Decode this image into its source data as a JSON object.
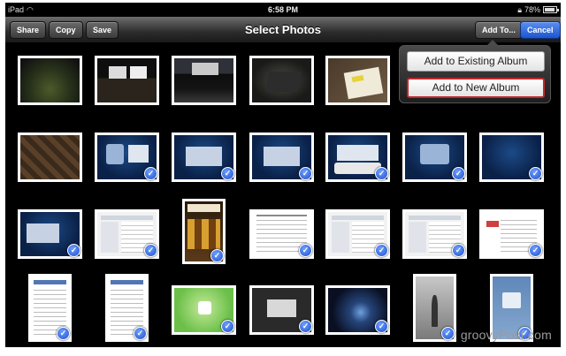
{
  "status": {
    "device": "iPad",
    "time": "6:58 PM",
    "battery": "78%",
    "battery_level": 0.78,
    "wifi_icon": "wifi-icon",
    "lock_icon": "lock-icon"
  },
  "toolbar": {
    "share_label": "Share",
    "copy_label": "Copy",
    "save_label": "Save",
    "title": "Select Photos",
    "add_to_label": "Add To...",
    "cancel_label": "Cancel",
    "cancel_color": "#1b55d0"
  },
  "popover": {
    "items": [
      "Add to Existing Album",
      "Add to New Album"
    ],
    "highlight_color": "#c0282c"
  },
  "photos": {
    "selected_mark": "✓"
  },
  "watermark": "groovyPost.com"
}
